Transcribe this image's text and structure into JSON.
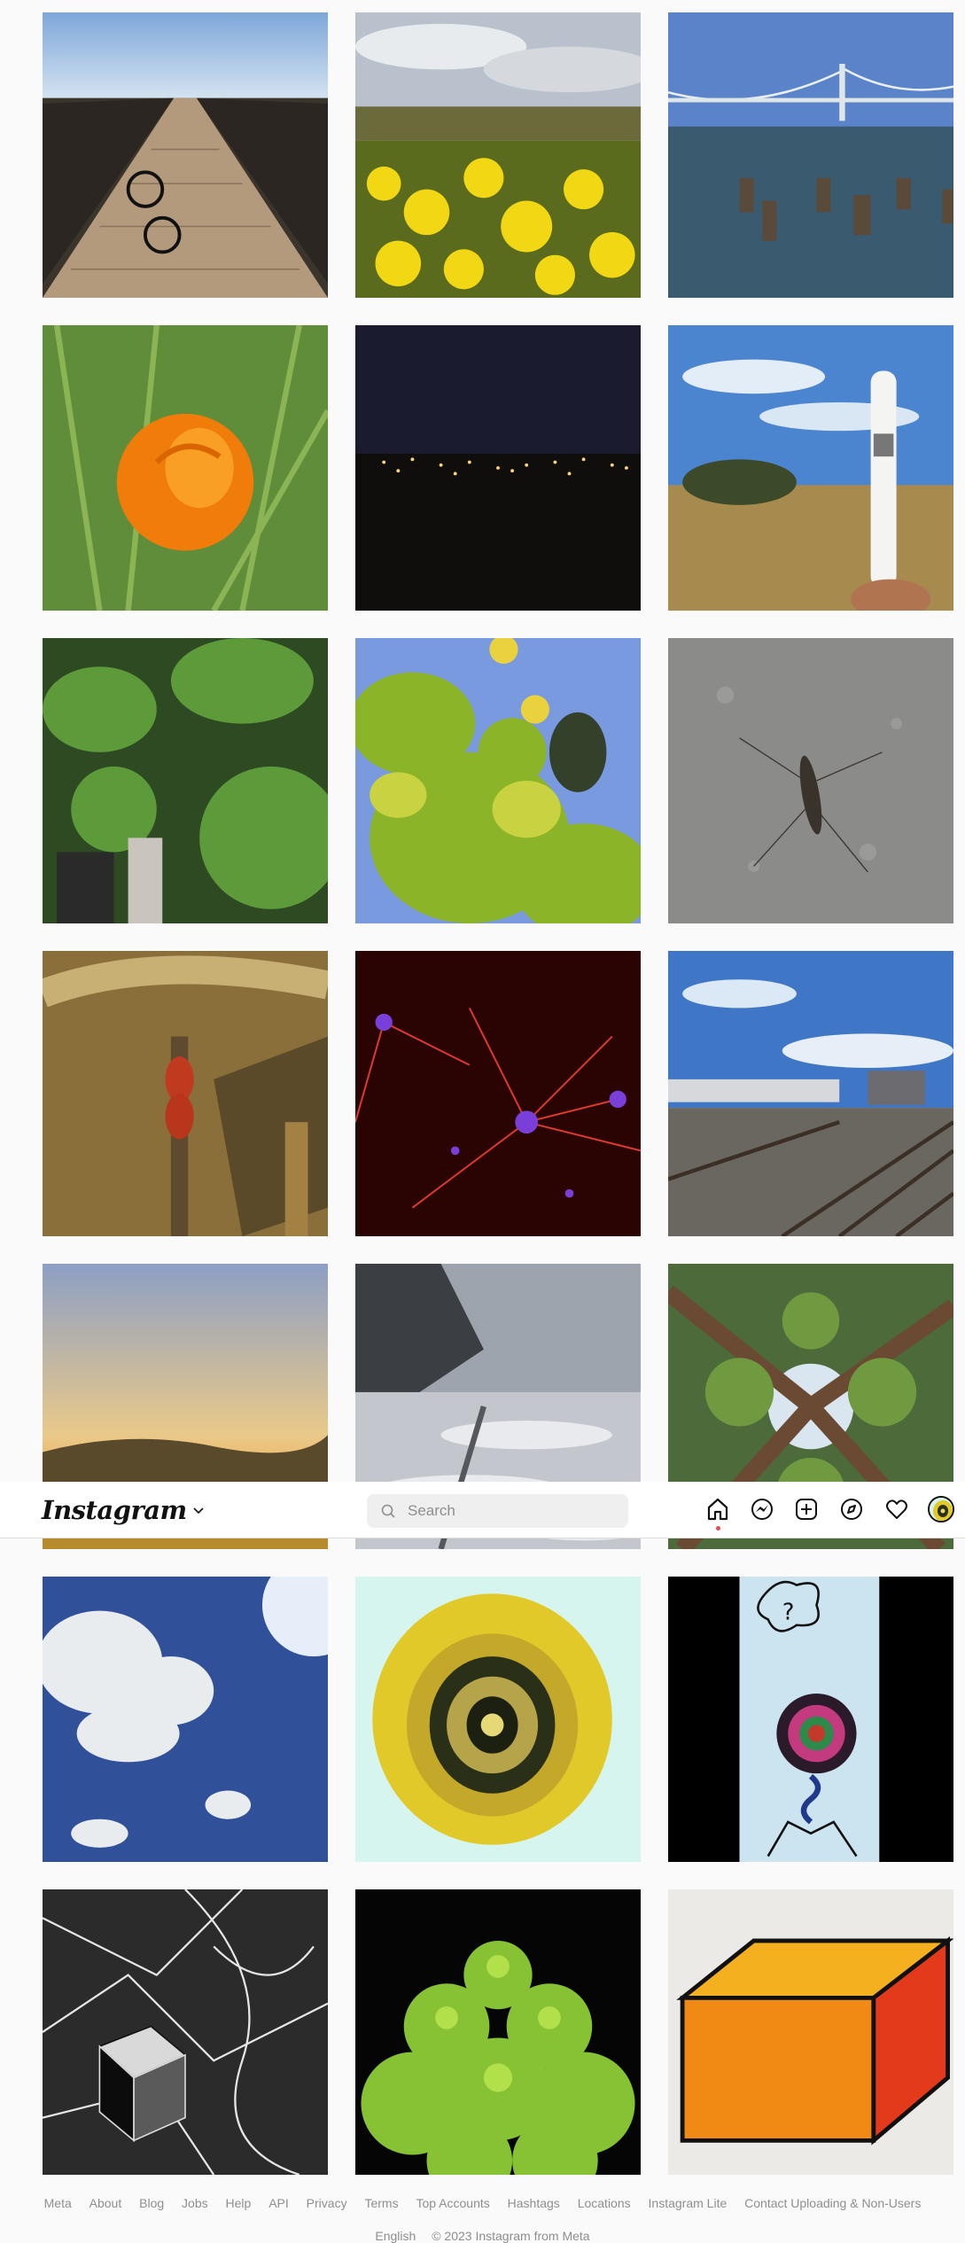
{
  "header": {
    "logo_text": "Instagram",
    "search_placeholder": "Search",
    "nav_icons": [
      "home-icon",
      "messenger-icon",
      "new-post-icon",
      "explore-icon",
      "activity-heart-icon",
      "profile-avatar"
    ]
  },
  "posts": [
    {
      "subject": "boardwalk pier with bicycle"
    },
    {
      "subject": "yellow mustard flowers field"
    },
    {
      "subject": "bay bridge with pilings in water"
    },
    {
      "subject": "orange california poppy"
    },
    {
      "subject": "city lights at night"
    },
    {
      "subject": "white vape pen held in hand over hill"
    },
    {
      "subject": "green plants in garden beds"
    },
    {
      "subject": "lemon tree branches"
    },
    {
      "subject": "crane fly on concrete"
    },
    {
      "subject": "red bugs on dry leaves"
    },
    {
      "subject": "fluorescent neurons micrograph"
    },
    {
      "subject": "train tracks with passing train"
    },
    {
      "subject": "sunset over golden hills"
    },
    {
      "subject": "foggy snowy coastline"
    },
    {
      "subject": "redwood trees looking up"
    },
    {
      "subject": "clouds in blue sky with sun"
    },
    {
      "subject": "yellow agate slice"
    },
    {
      "subject": "drawing of spiral creature with question bubble"
    },
    {
      "subject": "black and white pen drawing with cube"
    },
    {
      "subject": "green romanesco broccoli"
    },
    {
      "subject": "orange drawn cube"
    }
  ],
  "footer": {
    "links": [
      "Meta",
      "About",
      "Blog",
      "Jobs",
      "Help",
      "API",
      "Privacy",
      "Terms",
      "Top Accounts",
      "Hashtags",
      "Locations",
      "Instagram Lite",
      "Contact Uploading & Non-Users"
    ],
    "language": "English",
    "copyright": "© 2023 Instagram from Meta"
  },
  "colors": {
    "background": "#fafafa",
    "notification_dot": "#ed4956",
    "search_bg": "#efefef"
  }
}
